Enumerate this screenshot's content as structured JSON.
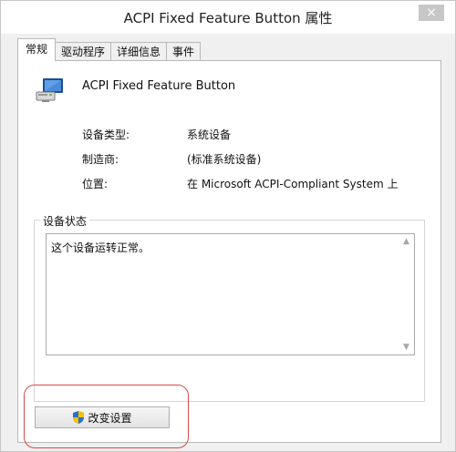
{
  "window": {
    "title": "ACPI Fixed Feature Button 属性",
    "close_glyph": "×"
  },
  "tabs": [
    {
      "label": "常规",
      "active": true
    },
    {
      "label": "驱动程序",
      "active": false
    },
    {
      "label": "详细信息",
      "active": false
    },
    {
      "label": "事件",
      "active": false
    }
  ],
  "general": {
    "device_name": "ACPI Fixed Feature Button",
    "device_icon": "monitor-icon",
    "properties": [
      {
        "label": "设备类型:",
        "value": "系统设备"
      },
      {
        "label": "制造商:",
        "value": "(标准系统设备)"
      },
      {
        "label": "位置:",
        "value": "在 Microsoft ACPI-Compliant System 上"
      }
    ],
    "status_group_label": "设备状态",
    "status_text": "这个设备运转正常。",
    "change_settings_label": "改变设置",
    "change_settings_icon": "uac-shield-icon"
  },
  "colors": {
    "highlight": "#d94a4a",
    "panel": "#ffffff",
    "window_bg": "#f0f0f0"
  }
}
